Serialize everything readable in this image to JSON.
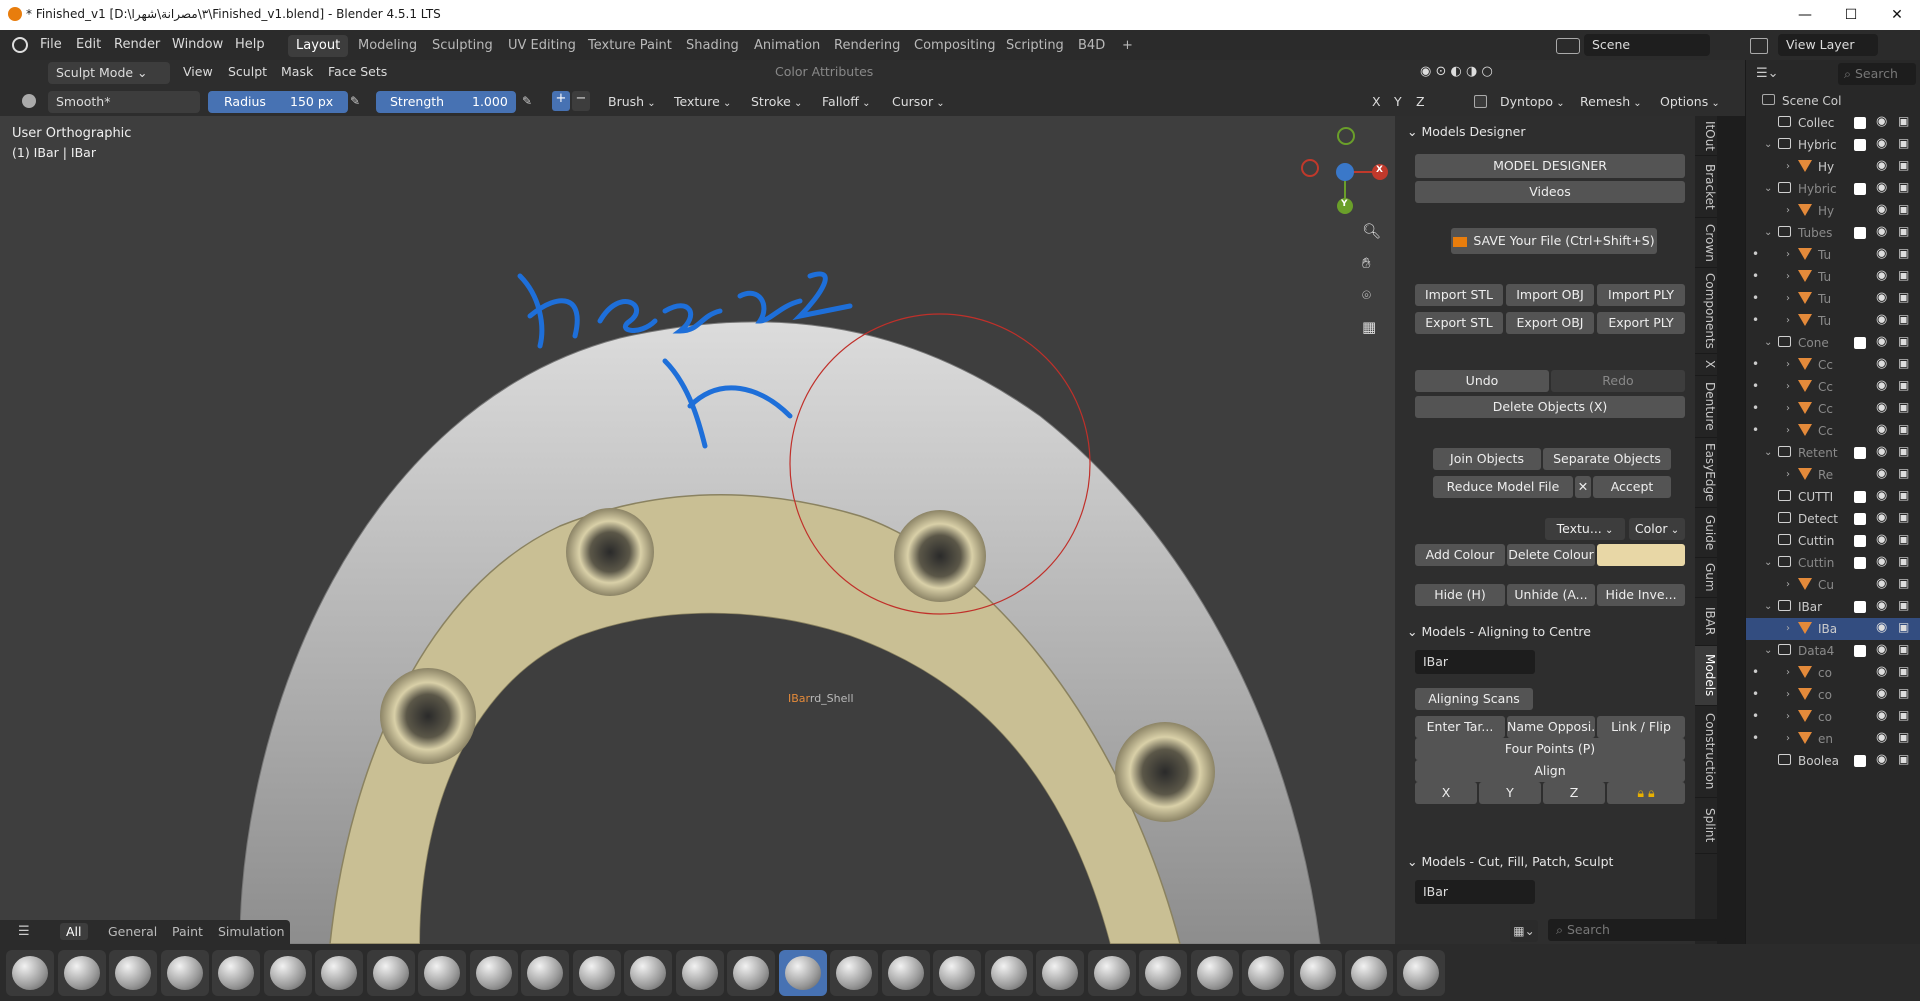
{
  "window": {
    "title": "* Finished_v1 [D:\\٣\\مصرانة\\شهرا\\Finished_v1.blend] - Blender 4.5.1 LTS",
    "minimize": "—",
    "maximize": "☐",
    "close": "✕"
  },
  "menu": {
    "items": [
      "File",
      "Edit",
      "Render",
      "Window",
      "Help"
    ],
    "workspaces": [
      "Layout",
      "Modeling",
      "Sculpting",
      "UV Editing",
      "Texture Paint",
      "Shading",
      "Animation",
      "Rendering",
      "Compositing",
      "Scripting",
      "B4D"
    ],
    "active_workspace": "Layout",
    "add_tab": "+",
    "scene": "Scene",
    "view_layer": "View Layer"
  },
  "header": {
    "mode": "Sculpt Mode",
    "menus": [
      "View",
      "Sculpt",
      "Mask",
      "Face Sets"
    ],
    "color_attributes": "Color Attributes"
  },
  "tool_header": {
    "brush_name": "Smooth*",
    "radius_label": "Radius",
    "radius_value": "150 px",
    "strength_label": "Strength",
    "strength_value": "1.000",
    "plus": "+",
    "minus": "−",
    "menus": [
      "Brush",
      "Texture",
      "Stroke",
      "Falloff",
      "Cursor"
    ],
    "axes": [
      "X",
      "Y",
      "Z"
    ],
    "dyntopo": "Dyntopo",
    "remesh": "Remesh",
    "options": "Options"
  },
  "viewport": {
    "view_name": "User Orthographic",
    "object_info": "(1) IBar | IBar",
    "object_label_active": "IBar",
    "object_label_rest": "rd_Shell",
    "annotation_text": "henze2",
    "gizmo": {
      "x": "X",
      "y": "Y"
    },
    "colors": {
      "background": "#3e3e3e",
      "bar": "#c9bf94",
      "shell": "#b8b8b8",
      "brush_circle": "#c0302a",
      "annotation": "#1e6fd9"
    }
  },
  "npanel": {
    "models_designer": {
      "title": "Models Designer",
      "model_designer_btn": "MODEL DESIGNER",
      "videos_btn": "Videos",
      "save_btn": "SAVE Your File (Ctrl+Shift+S)",
      "import_stl": "Import STL",
      "import_obj": "Import OBJ",
      "import_ply": "Import PLY",
      "export_stl": "Export STL",
      "export_obj": "Export OBJ",
      "export_ply": "Export PLY",
      "undo": "Undo",
      "redo": "Redo",
      "delete": "Delete Objects (X)",
      "join": "Join Objects",
      "separate": "Separate Objects",
      "reduce": "Reduce Model File",
      "accept": "Accept",
      "texture_dd": "Textu...",
      "color_dd": "Color",
      "add_colour": "Add Colour",
      "delete_colour": "Delete Colour",
      "colour_swatch": "#e8d7a6",
      "hide": "Hide (H)",
      "unhide": "Unhide (A...",
      "hide_inverse": "Hide Inve..."
    },
    "aligning": {
      "title": "Models - Aligning to Centre",
      "field": "IBar",
      "aligning_scans": "Aligning Scans",
      "enter_target": "Enter Tar...",
      "name_opposite": "Name Opposi...",
      "link_flip": "Link / Flip",
      "four_points": "Four Points (P)",
      "align": "Align",
      "x": "X",
      "y": "Y",
      "z": "Z"
    },
    "cut": {
      "title": "Models - Cut, Fill, Patch, Sculpt",
      "field": "IBar"
    },
    "tabs": [
      "ItOut",
      "Bracket",
      "Crown",
      "Components",
      "X",
      "Denture",
      "EasyEdge",
      "Guide",
      "Gum",
      "IBAR",
      "Models",
      "Construction",
      "Splint"
    ],
    "active_tab": "Models"
  },
  "outliner": {
    "search_placeholder": "Search",
    "rows": [
      {
        "label": "Scene Col",
        "type": "scene",
        "indent": 0
      },
      {
        "label": "Collec",
        "type": "coll",
        "indent": 1,
        "check": true
      },
      {
        "label": "Hybric",
        "type": "coll",
        "indent": 1,
        "check": true,
        "open": true
      },
      {
        "label": "Hy",
        "type": "mesh",
        "indent": 2
      },
      {
        "label": "Hybric",
        "type": "coll",
        "indent": 1,
        "check": true,
        "open": true,
        "dim": true
      },
      {
        "label": "Hy",
        "type": "mesh",
        "indent": 2,
        "dim": true
      },
      {
        "label": "Tubes",
        "type": "coll",
        "indent": 1,
        "check": true,
        "open": true,
        "dim": true
      },
      {
        "label": "Tu",
        "type": "mesh",
        "indent": 2,
        "dot": true,
        "dim": true
      },
      {
        "label": "Tu",
        "type": "mesh",
        "indent": 2,
        "dot": true,
        "dim": true
      },
      {
        "label": "Tu",
        "type": "mesh",
        "indent": 2,
        "dot": true,
        "dim": true
      },
      {
        "label": "Tu",
        "type": "mesh",
        "indent": 2,
        "dot": true,
        "dim": true
      },
      {
        "label": "Cone",
        "type": "coll",
        "indent": 1,
        "check": true,
        "open": true,
        "dim": true
      },
      {
        "label": "Cc",
        "type": "mesh",
        "indent": 2,
        "dot": true,
        "dim": true
      },
      {
        "label": "Cc",
        "type": "mesh",
        "indent": 2,
        "dot": true,
        "dim": true
      },
      {
        "label": "Cc",
        "type": "mesh",
        "indent": 2,
        "dot": true,
        "dim": true
      },
      {
        "label": "Cc",
        "type": "mesh",
        "indent": 2,
        "dot": true,
        "dim": true
      },
      {
        "label": "Retent",
        "type": "coll",
        "indent": 1,
        "check": true,
        "open": true,
        "dim": true
      },
      {
        "label": "Re",
        "type": "mesh",
        "indent": 2,
        "dim": true
      },
      {
        "label": "CUTTI",
        "type": "coll",
        "indent": 1,
        "check": true
      },
      {
        "label": "Detect",
        "type": "coll",
        "indent": 1,
        "check": true
      },
      {
        "label": "Cuttin",
        "type": "coll",
        "indent": 1,
        "check": true
      },
      {
        "label": "Cuttin",
        "type": "coll",
        "indent": 1,
        "check": true,
        "open": true,
        "dim": true
      },
      {
        "label": "Cu",
        "type": "mesh",
        "indent": 2,
        "dim": true
      },
      {
        "label": "IBar",
        "type": "coll",
        "indent": 1,
        "check": true,
        "open": true
      },
      {
        "label": "IBa",
        "type": "mesh",
        "indent": 2,
        "selected": true
      },
      {
        "label": "Data4",
        "type": "coll",
        "indent": 1,
        "check": true,
        "open": true,
        "dim": true
      },
      {
        "label": "co",
        "type": "mesh",
        "indent": 2,
        "dot": true,
        "dim": true
      },
      {
        "label": "co",
        "type": "mesh",
        "indent": 2,
        "dot": true,
        "dim": true
      },
      {
        "label": "co",
        "type": "mesh",
        "indent": 2,
        "dot": true,
        "dim": true
      },
      {
        "label": "en",
        "type": "mesh",
        "indent": 2,
        "dot": true,
        "dim": true
      },
      {
        "label": "Boolea",
        "type": "coll",
        "indent": 1,
        "check": true
      }
    ]
  },
  "asset_shelf": {
    "tabs": [
      "All",
      "General",
      "Paint",
      "Simulation"
    ],
    "active_tab": "All",
    "search_placeholder": "Search",
    "brush_count": 28,
    "active_index": 15
  }
}
